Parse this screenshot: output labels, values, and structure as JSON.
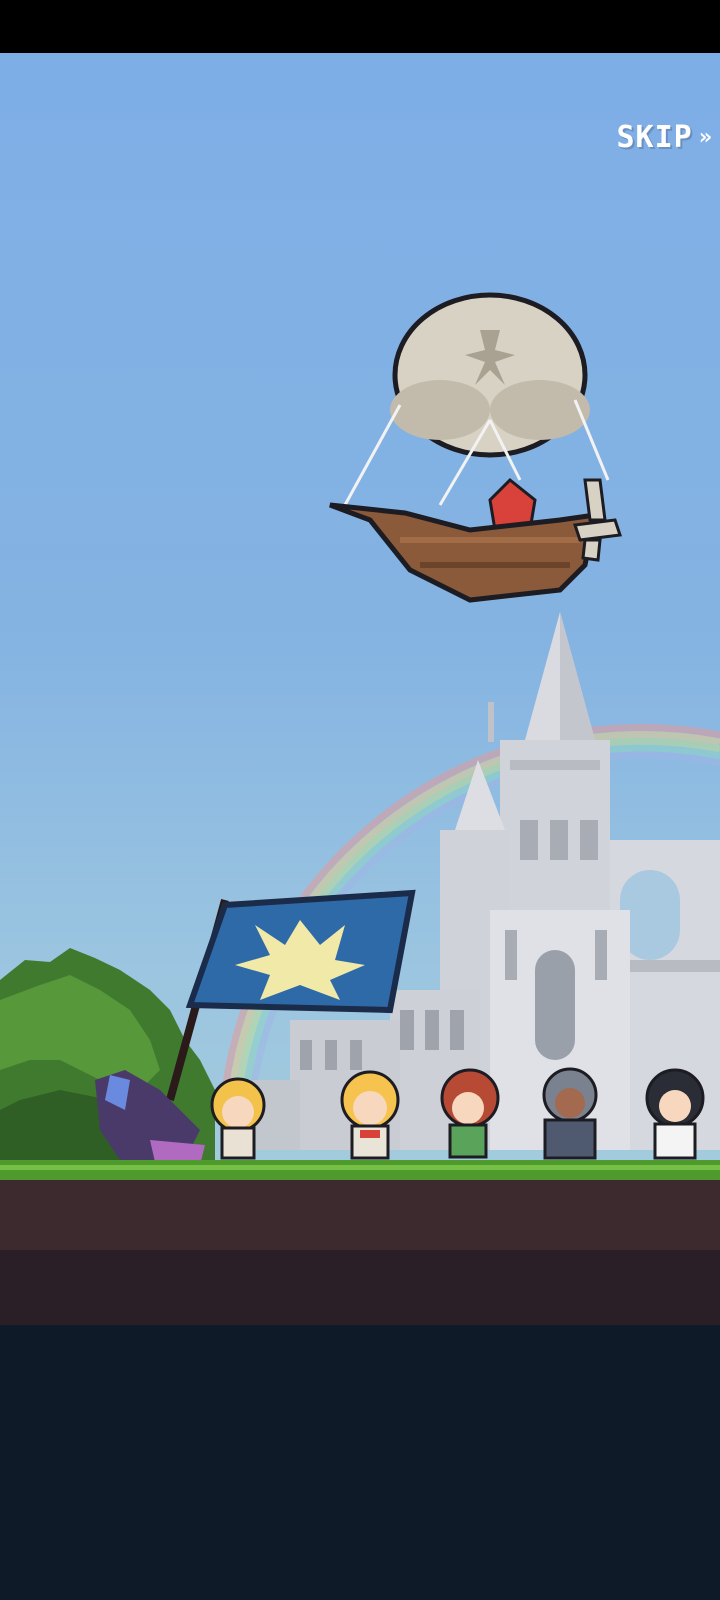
{
  "skip": {
    "label": "SKIP",
    "chevrons": "»"
  },
  "colors": {
    "sky_top": "#7eaee6",
    "grass": "#4f9a2c",
    "dirt": "#3d2a2e",
    "panel": "#0f1a28",
    "banner": "#2f6aa8",
    "castle": "#d7d9de"
  },
  "scene": {
    "characters": [
      "dark-winged-creature",
      "blonde-elf",
      "blonde-hero",
      "red-haired-girl",
      "armored-knight",
      "dark-haired-maid"
    ]
  }
}
